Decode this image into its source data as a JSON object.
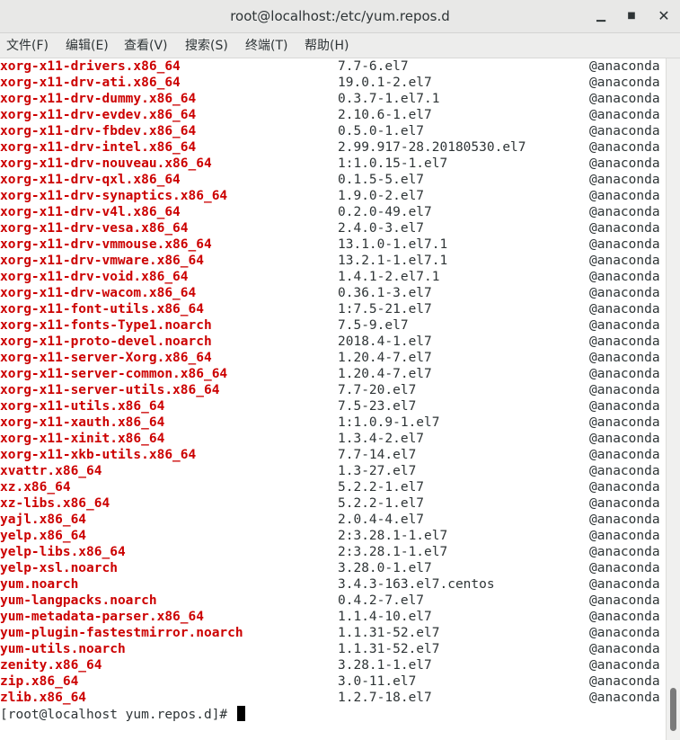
{
  "window": {
    "title": "root@localhost:/etc/yum.repos.d",
    "minimize_glyph": "▁",
    "maximize_glyph": "■",
    "close_glyph": "✕"
  },
  "menu": [
    "文件(F)",
    "编辑(E)",
    "查看(V)",
    "搜索(S)",
    "终端(T)",
    "帮助(H)"
  ],
  "packages": [
    {
      "name": "xorg-x11-drivers.x86_64",
      "version": "7.7-6.el7",
      "repo": "@anaconda"
    },
    {
      "name": "xorg-x11-drv-ati.x86_64",
      "version": "19.0.1-2.el7",
      "repo": "@anaconda"
    },
    {
      "name": "xorg-x11-drv-dummy.x86_64",
      "version": "0.3.7-1.el7.1",
      "repo": "@anaconda"
    },
    {
      "name": "xorg-x11-drv-evdev.x86_64",
      "version": "2.10.6-1.el7",
      "repo": "@anaconda"
    },
    {
      "name": "xorg-x11-drv-fbdev.x86_64",
      "version": "0.5.0-1.el7",
      "repo": "@anaconda"
    },
    {
      "name": "xorg-x11-drv-intel.x86_64",
      "version": "2.99.917-28.20180530.el7",
      "repo": "@anaconda"
    },
    {
      "name": "xorg-x11-drv-nouveau.x86_64",
      "version": "1:1.0.15-1.el7",
      "repo": "@anaconda"
    },
    {
      "name": "xorg-x11-drv-qxl.x86_64",
      "version": "0.1.5-5.el7",
      "repo": "@anaconda"
    },
    {
      "name": "xorg-x11-drv-synaptics.x86_64",
      "version": "1.9.0-2.el7",
      "repo": "@anaconda"
    },
    {
      "name": "xorg-x11-drv-v4l.x86_64",
      "version": "0.2.0-49.el7",
      "repo": "@anaconda"
    },
    {
      "name": "xorg-x11-drv-vesa.x86_64",
      "version": "2.4.0-3.el7",
      "repo": "@anaconda"
    },
    {
      "name": "xorg-x11-drv-vmmouse.x86_64",
      "version": "13.1.0-1.el7.1",
      "repo": "@anaconda"
    },
    {
      "name": "xorg-x11-drv-vmware.x86_64",
      "version": "13.2.1-1.el7.1",
      "repo": "@anaconda"
    },
    {
      "name": "xorg-x11-drv-void.x86_64",
      "version": "1.4.1-2.el7.1",
      "repo": "@anaconda"
    },
    {
      "name": "xorg-x11-drv-wacom.x86_64",
      "version": "0.36.1-3.el7",
      "repo": "@anaconda"
    },
    {
      "name": "xorg-x11-font-utils.x86_64",
      "version": "1:7.5-21.el7",
      "repo": "@anaconda"
    },
    {
      "name": "xorg-x11-fonts-Type1.noarch",
      "version": "7.5-9.el7",
      "repo": "@anaconda"
    },
    {
      "name": "xorg-x11-proto-devel.noarch",
      "version": "2018.4-1.el7",
      "repo": "@anaconda"
    },
    {
      "name": "xorg-x11-server-Xorg.x86_64",
      "version": "1.20.4-7.el7",
      "repo": "@anaconda"
    },
    {
      "name": "xorg-x11-server-common.x86_64",
      "version": "1.20.4-7.el7",
      "repo": "@anaconda"
    },
    {
      "name": "xorg-x11-server-utils.x86_64",
      "version": "7.7-20.el7",
      "repo": "@anaconda"
    },
    {
      "name": "xorg-x11-utils.x86_64",
      "version": "7.5-23.el7",
      "repo": "@anaconda"
    },
    {
      "name": "xorg-x11-xauth.x86_64",
      "version": "1:1.0.9-1.el7",
      "repo": "@anaconda"
    },
    {
      "name": "xorg-x11-xinit.x86_64",
      "version": "1.3.4-2.el7",
      "repo": "@anaconda"
    },
    {
      "name": "xorg-x11-xkb-utils.x86_64",
      "version": "7.7-14.el7",
      "repo": "@anaconda"
    },
    {
      "name": "xvattr.x86_64",
      "version": "1.3-27.el7",
      "repo": "@anaconda"
    },
    {
      "name": "xz.x86_64",
      "version": "5.2.2-1.el7",
      "repo": "@anaconda"
    },
    {
      "name": "xz-libs.x86_64",
      "version": "5.2.2-1.el7",
      "repo": "@anaconda"
    },
    {
      "name": "yajl.x86_64",
      "version": "2.0.4-4.el7",
      "repo": "@anaconda"
    },
    {
      "name": "yelp.x86_64",
      "version": "2:3.28.1-1.el7",
      "repo": "@anaconda"
    },
    {
      "name": "yelp-libs.x86_64",
      "version": "2:3.28.1-1.el7",
      "repo": "@anaconda"
    },
    {
      "name": "yelp-xsl.noarch",
      "version": "3.28.0-1.el7",
      "repo": "@anaconda"
    },
    {
      "name": "yum.noarch",
      "version": "3.4.3-163.el7.centos",
      "repo": "@anaconda"
    },
    {
      "name": "yum-langpacks.noarch",
      "version": "0.4.2-7.el7",
      "repo": "@anaconda"
    },
    {
      "name": "yum-metadata-parser.x86_64",
      "version": "1.1.4-10.el7",
      "repo": "@anaconda"
    },
    {
      "name": "yum-plugin-fastestmirror.noarch",
      "version": "1.1.31-52.el7",
      "repo": "@anaconda"
    },
    {
      "name": "yum-utils.noarch",
      "version": "1.1.31-52.el7",
      "repo": "@anaconda"
    },
    {
      "name": "zenity.x86_64",
      "version": "3.28.1-1.el7",
      "repo": "@anaconda"
    },
    {
      "name": "zip.x86_64",
      "version": "3.0-11.el7",
      "repo": "@anaconda"
    },
    {
      "name": "zlib.x86_64",
      "version": "1.2.7-18.el7",
      "repo": "@anaconda"
    }
  ],
  "prompt": "[root@localhost yum.repos.d]# ",
  "colors": {
    "package_name": "#cc0000",
    "text": "#2e3436",
    "background": "#ffffff"
  }
}
